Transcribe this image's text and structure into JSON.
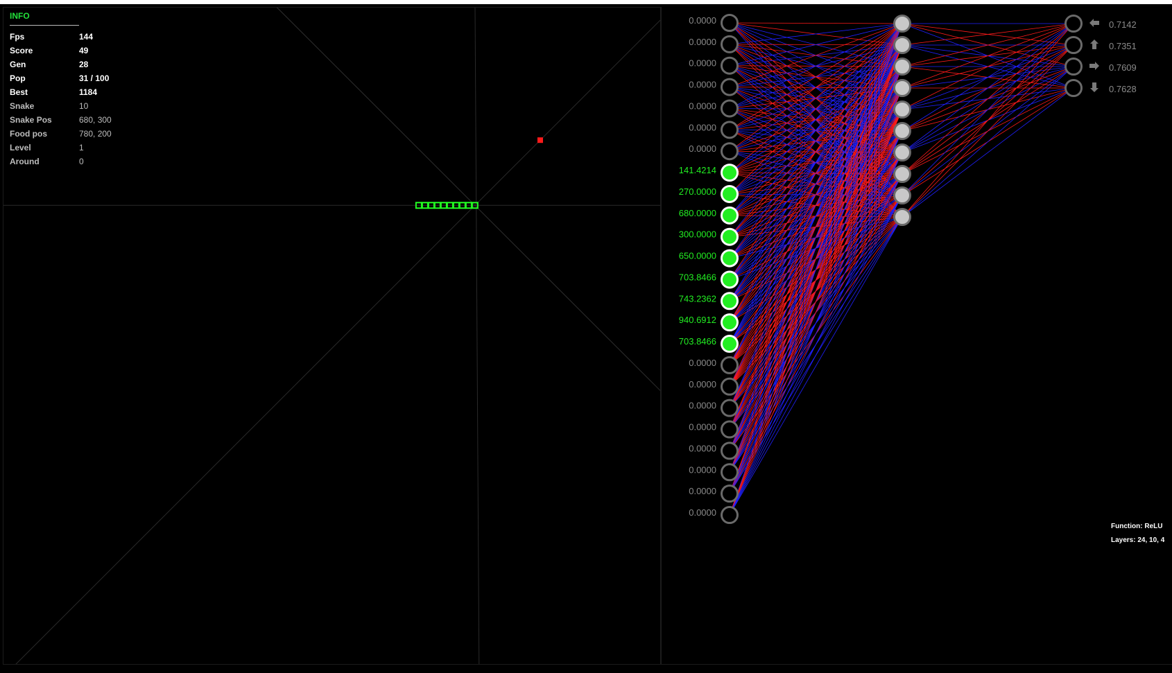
{
  "info": {
    "title": "INFO",
    "rows": [
      {
        "label": "Fps",
        "value": "144",
        "style": "bright"
      },
      {
        "label": "Score",
        "value": "49",
        "style": "bright"
      },
      {
        "label": "Gen",
        "value": "28",
        "style": "bright"
      },
      {
        "label": "Pop",
        "value": "31 / 100",
        "style": "bright"
      },
      {
        "label": "Best",
        "value": "1184",
        "style": "bright"
      },
      {
        "label": "Snake",
        "value": "10",
        "style": "dim"
      },
      {
        "label": "Snake Pos",
        "value": "680, 300",
        "style": "dim"
      },
      {
        "label": "Food pos",
        "value": "780, 200",
        "style": "dim"
      },
      {
        "label": "Level",
        "value": "1",
        "style": "dim"
      },
      {
        "label": "Around",
        "value": "0",
        "style": "dim"
      }
    ]
  },
  "game": {
    "snake_length": 10,
    "snake_head": [
      680,
      300
    ],
    "food": [
      780,
      200
    ],
    "colors": {
      "snake": "#22ff22",
      "food": "#ff1a1a",
      "rays": "#2a2a2a"
    }
  },
  "network": {
    "inputs": [
      "0.0000",
      "0.0000",
      "0.0000",
      "0.0000",
      "0.0000",
      "0.0000",
      "0.0000",
      "141.4214",
      "270.0000",
      "680.0000",
      "300.0000",
      "650.0000",
      "703.8466",
      "743.2362",
      "940.6912",
      "703.8466",
      "0.0000",
      "0.0000",
      "0.0000",
      "0.0000",
      "0.0000",
      "0.0000",
      "0.0000",
      "0.0000"
    ],
    "hidden_count": 10,
    "outputs": [
      {
        "value": "0.7142",
        "icon": "arrow-left-icon"
      },
      {
        "value": "0.7351",
        "icon": "arrow-up-icon"
      },
      {
        "value": "0.7609",
        "icon": "arrow-right-icon"
      },
      {
        "value": "0.7628",
        "icon": "arrow-down-icon"
      }
    ],
    "colors": {
      "active": "#22ee22",
      "inactive_ring": "#6a6a6a",
      "hidden_fill": "#c8c8c8",
      "pos_weight": "#ff1a1a",
      "neg_weight": "#2020ff",
      "inactive_text": "#8a8a8a"
    }
  },
  "footer": {
    "function": "Function: ReLU",
    "layers": "Layers: 24, 10, 4"
  }
}
